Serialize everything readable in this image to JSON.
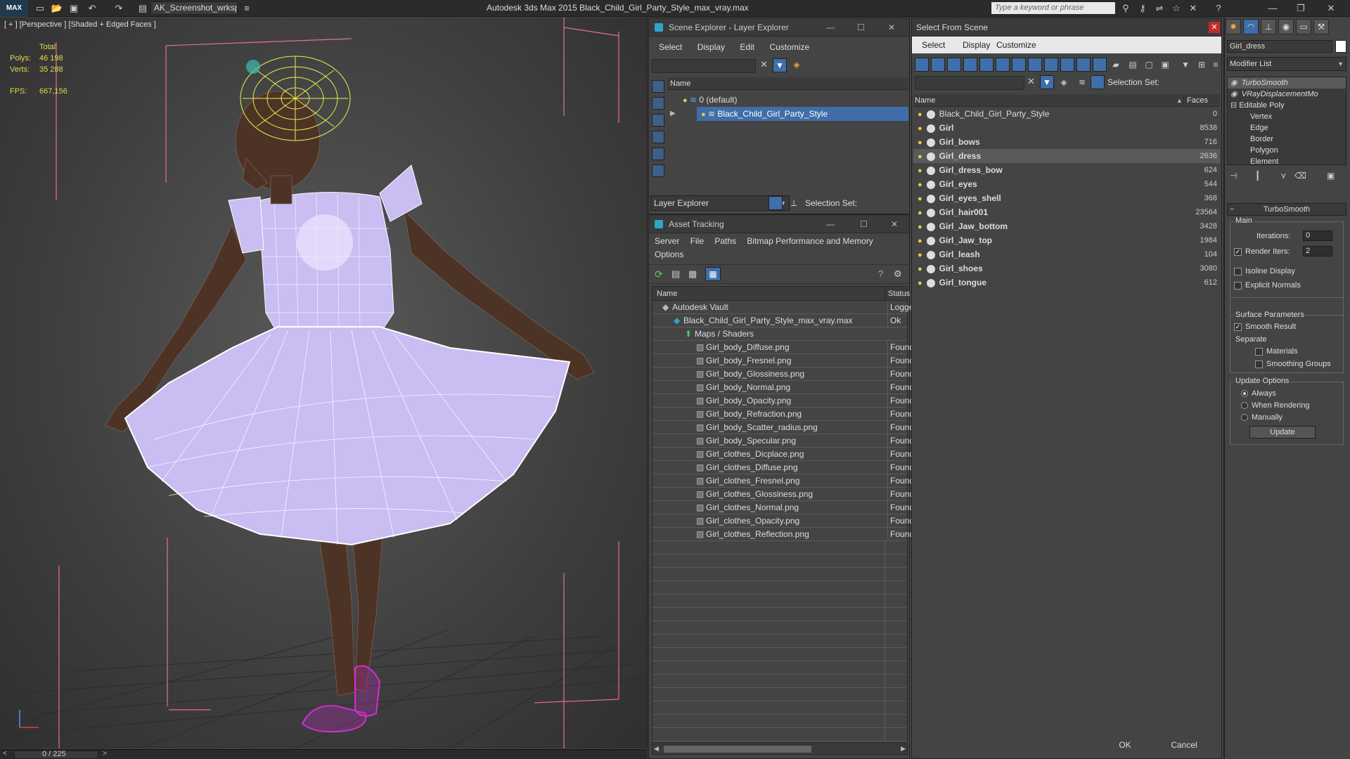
{
  "app": {
    "logo": "MAX",
    "workspace": "AK_Screenshot_wrksp",
    "title": "Autodesk 3ds Max  2015    Black_Child_Girl_Party_Style_max_vray.max",
    "search_placeholder": "Type a keyword or phrase"
  },
  "viewport": {
    "label": "[ + ] [Perspective ] [Shaded + Edged Faces ]",
    "stats": {
      "total_label": "Total",
      "polys_label": "Polys:",
      "polys_value": "46 198",
      "verts_label": "Verts:",
      "verts_value": "35 288",
      "fps_label": "FPS:",
      "fps_value": "667,156"
    },
    "timeline": "0 / 225"
  },
  "scene_explorer": {
    "title": "Scene Explorer - Layer Explorer",
    "menu": [
      "Select",
      "Display",
      "Edit",
      "Customize"
    ],
    "column_name": "Name",
    "layers": [
      {
        "name": "0 (default)",
        "selected": false
      },
      {
        "name": "Black_Child_Girl_Party_Style",
        "selected": true
      }
    ],
    "footer_dropdown": "Layer Explorer",
    "selection_set_label": "Selection Set:"
  },
  "asset_tracking": {
    "title": "Asset Tracking",
    "menu": [
      "Server",
      "File",
      "Paths",
      "Bitmap Performance and Memory"
    ],
    "menu2": "Options",
    "col_name": "Name",
    "col_status": "Status",
    "rows": [
      {
        "name": "Autodesk Vault",
        "status": "Logged",
        "indent": 1
      },
      {
        "name": "Black_Child_Girl_Party_Style_max_vray.max",
        "status": "Ok",
        "indent": 2
      },
      {
        "name": "Maps / Shaders",
        "status": "",
        "indent": 3
      },
      {
        "name": "Girl_body_Diffuse.png",
        "status": "Found",
        "indent": 4
      },
      {
        "name": "Girl_body_Fresnel.png",
        "status": "Found",
        "indent": 4
      },
      {
        "name": "Girl_body_Glossiness.png",
        "status": "Found",
        "indent": 4
      },
      {
        "name": "Girl_body_Normal.png",
        "status": "Found",
        "indent": 4
      },
      {
        "name": "Girl_body_Opacity.png",
        "status": "Found",
        "indent": 4
      },
      {
        "name": "Girl_body_Refraction.png",
        "status": "Found",
        "indent": 4
      },
      {
        "name": "Girl_body_Scatter_radius.png",
        "status": "Found",
        "indent": 4
      },
      {
        "name": "Girl_body_Specular.png",
        "status": "Found",
        "indent": 4
      },
      {
        "name": "Girl_clothes_Dicplace.png",
        "status": "Found",
        "indent": 4
      },
      {
        "name": "Girl_clothes_Diffuse.png",
        "status": "Found",
        "indent": 4
      },
      {
        "name": "Girl_clothes_Fresnel.png",
        "status": "Found",
        "indent": 4
      },
      {
        "name": "Girl_clothes_Glossiness.png",
        "status": "Found",
        "indent": 4
      },
      {
        "name": "Girl_clothes_Normal.png",
        "status": "Found",
        "indent": 4
      },
      {
        "name": "Girl_clothes_Opacity.png",
        "status": "Found",
        "indent": 4
      },
      {
        "name": "Girl_clothes_Reflection.png",
        "status": "Found",
        "indent": 4
      }
    ]
  },
  "select_from_scene": {
    "title": "Select From Scene",
    "menu": [
      "Select",
      "Display",
      "Customize"
    ],
    "selection_set_label": "Selection Set:",
    "col_name": "Name",
    "col_faces": "Faces",
    "rows": [
      {
        "name": "Black_Child_Girl_Party_Style",
        "faces": "0",
        "bold": false,
        "highlight": false
      },
      {
        "name": "Girl",
        "faces": "8538",
        "bold": true,
        "highlight": false
      },
      {
        "name": "Girl_bows",
        "faces": "716",
        "bold": true,
        "highlight": false
      },
      {
        "name": "Girl_dress",
        "faces": "2636",
        "bold": true,
        "highlight": true
      },
      {
        "name": "Girl_dress_bow",
        "faces": "624",
        "bold": true,
        "highlight": false
      },
      {
        "name": "Girl_eyes",
        "faces": "544",
        "bold": true,
        "highlight": false
      },
      {
        "name": "Girl_eyes_shell",
        "faces": "368",
        "bold": true,
        "highlight": false
      },
      {
        "name": "Girl_hair001",
        "faces": "23564",
        "bold": true,
        "highlight": false
      },
      {
        "name": "Girl_Jaw_bottom",
        "faces": "3428",
        "bold": true,
        "highlight": false
      },
      {
        "name": "Girl_Jaw_top",
        "faces": "1984",
        "bold": true,
        "highlight": false
      },
      {
        "name": "Girl_leash",
        "faces": "104",
        "bold": true,
        "highlight": false
      },
      {
        "name": "Girl_shoes",
        "faces": "3080",
        "bold": true,
        "highlight": false
      },
      {
        "name": "Girl_tongue",
        "faces": "612",
        "bold": true,
        "highlight": false
      }
    ],
    "ok_label": "OK",
    "cancel_label": "Cancel"
  },
  "command_panel": {
    "object_name": "Girl_dress",
    "modifier_list": "Modifier List",
    "stack": [
      "TurboSmooth",
      "VRayDisplacementMo",
      "Editable Poly",
      "Vertex",
      "Edge",
      "Border",
      "Polygon",
      "Element"
    ],
    "rollout_title": "TurboSmooth",
    "main_label": "Main",
    "iterations_label": "Iterations:",
    "iterations_value": "0",
    "render_iters_label": "Render Iters:",
    "render_iters_value": "2",
    "isoline_label": "Isoline Display",
    "explicit_normals_label": "Explicit Normals",
    "surface_params_label": "Surface Parameters",
    "smooth_result_label": "Smooth Result",
    "separate_label": "Separate",
    "materials_label": "Materials",
    "smoothing_groups_label": "Smoothing Groups",
    "update_options_label": "Update Options",
    "always_label": "Always",
    "when_rendering_label": "When Rendering",
    "manually_label": "Manually",
    "update_button": "Update"
  }
}
